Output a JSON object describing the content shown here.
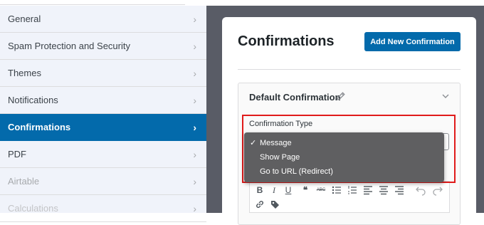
{
  "sidebar": {
    "items": [
      {
        "label": "General"
      },
      {
        "label": "Spam Protection and Security"
      },
      {
        "label": "Themes"
      },
      {
        "label": "Notifications"
      },
      {
        "label": "Confirmations"
      },
      {
        "label": "PDF"
      },
      {
        "label": "Airtable"
      },
      {
        "label": "Calculations"
      }
    ],
    "chevron": "›"
  },
  "main": {
    "title": "Confirmations",
    "add_button": "Add New Confirmation",
    "panel_title": "Default Confirmation",
    "field_label": "Confirmation Type",
    "dropdown": {
      "selected_mark": "✓",
      "options": [
        "Message",
        "Show Page",
        "Go to URL (Redirect)"
      ],
      "selected": "Message"
    },
    "toolbar": {
      "bold": "B",
      "italic": "I",
      "underline": "U",
      "quote": "❝",
      "strike": "ABC"
    }
  },
  "colors": {
    "accent": "#036aab",
    "highlight": "#e01b1b",
    "dropdown_bg": "#5f5f61"
  }
}
